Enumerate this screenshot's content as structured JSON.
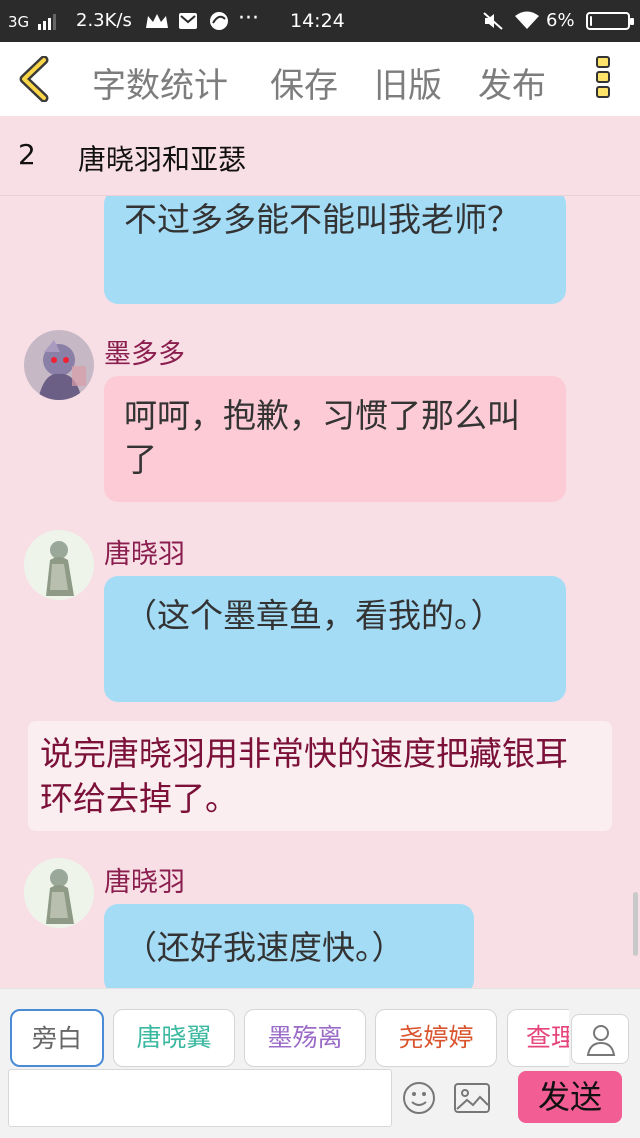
{
  "status_bar": {
    "network": "3G",
    "speed": "2.3K/s",
    "time": "14:24",
    "battery_text": "6%",
    "battery_level": 0.06
  },
  "toolbar": {
    "word_count_label": "字数统计",
    "save_label": "保存",
    "old_version_label": "旧版",
    "publish_label": "发布"
  },
  "chapter": {
    "number": "2",
    "title": "唐晓羽和亚瑟"
  },
  "messages": [
    {
      "text": "不过多多能不能叫我老师？"
    },
    {
      "speaker": "墨多多",
      "text": "呵呵，抱歉，习惯了那么叫了"
    },
    {
      "speaker": "唐晓羽",
      "text": "（这个墨章鱼，看我的。）"
    },
    {
      "narration": "说完唐晓羽用非常快的速度把藏银耳环给去掉了。"
    },
    {
      "speaker": "唐晓羽",
      "text": "（还好我速度快。）"
    }
  ],
  "roles": [
    {
      "label": "旁白",
      "color": "#666666"
    },
    {
      "label": "唐晓翼",
      "color": "#3bb8a0"
    },
    {
      "label": "墨殇离",
      "color": "#9a6cc7"
    },
    {
      "label": "尧婷婷",
      "color": "#d9532d"
    },
    {
      "label": "查理",
      "color": "#e6457a"
    }
  ],
  "input": {
    "value": "",
    "placeholder": ""
  },
  "send_label": "发送",
  "colors": {
    "toolbar_bg": "#ffffff",
    "page_bg": "#f8dfe5",
    "bubble_blue": "#a4dcf6",
    "bubble_pink": "#fccbd6",
    "narration_text": "#7b1038",
    "send_bg": "#f25d93"
  }
}
